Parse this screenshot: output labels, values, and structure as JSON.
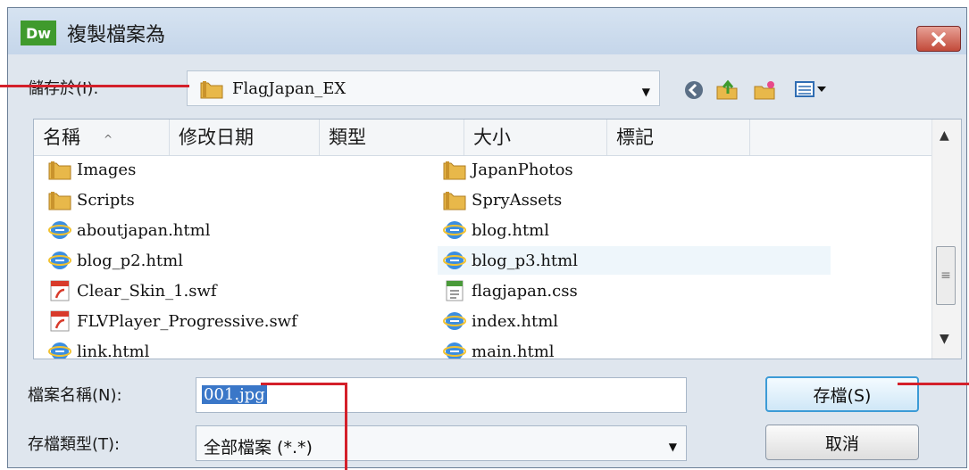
{
  "window": {
    "app_logo": "Dw",
    "title": "複製檔案為",
    "close_icon": "close-icon"
  },
  "save_in": {
    "label": "儲存於(I):",
    "value": "FlagJapan_EX",
    "toolbar_icons": [
      "back-icon",
      "up-folder-icon",
      "new-folder-icon",
      "view-menu-icon"
    ]
  },
  "file_list": {
    "columns": [
      "名稱",
      "修改日期",
      "類型",
      "大小",
      "標記"
    ],
    "items_left": [
      {
        "name": "Images",
        "icon": "folder-icon"
      },
      {
        "name": "Scripts",
        "icon": "folder-icon"
      },
      {
        "name": "aboutjapan.html",
        "icon": "ie-html-icon"
      },
      {
        "name": "blog_p2.html",
        "icon": "ie-html-icon"
      },
      {
        "name": "Clear_Skin_1.swf",
        "icon": "swf-icon"
      },
      {
        "name": "FLVPlayer_Progressive.swf",
        "icon": "swf-icon"
      },
      {
        "name": "link.html",
        "icon": "ie-html-icon"
      }
    ],
    "items_right": [
      {
        "name": "JapanPhotos",
        "icon": "folder-icon"
      },
      {
        "name": "SpryAssets",
        "icon": "folder-icon"
      },
      {
        "name": "blog.html",
        "icon": "ie-html-icon"
      },
      {
        "name": "blog_p3.html",
        "icon": "ie-html-icon",
        "selected": true
      },
      {
        "name": "flagjapan.css",
        "icon": "css-icon"
      },
      {
        "name": "index.html",
        "icon": "ie-html-icon"
      },
      {
        "name": "main.html",
        "icon": "ie-html-icon"
      }
    ]
  },
  "filename": {
    "label": "檔案名稱(N):",
    "value": "001.jpg"
  },
  "filetype": {
    "label": "存檔類型(T):",
    "value": "全部檔案 (*.*)"
  },
  "buttons": {
    "save": "存檔(S)",
    "cancel": "取消"
  },
  "colors": {
    "callout": "#d4202a",
    "selection": "#3a77c8",
    "logo": "#3f9a2d"
  }
}
